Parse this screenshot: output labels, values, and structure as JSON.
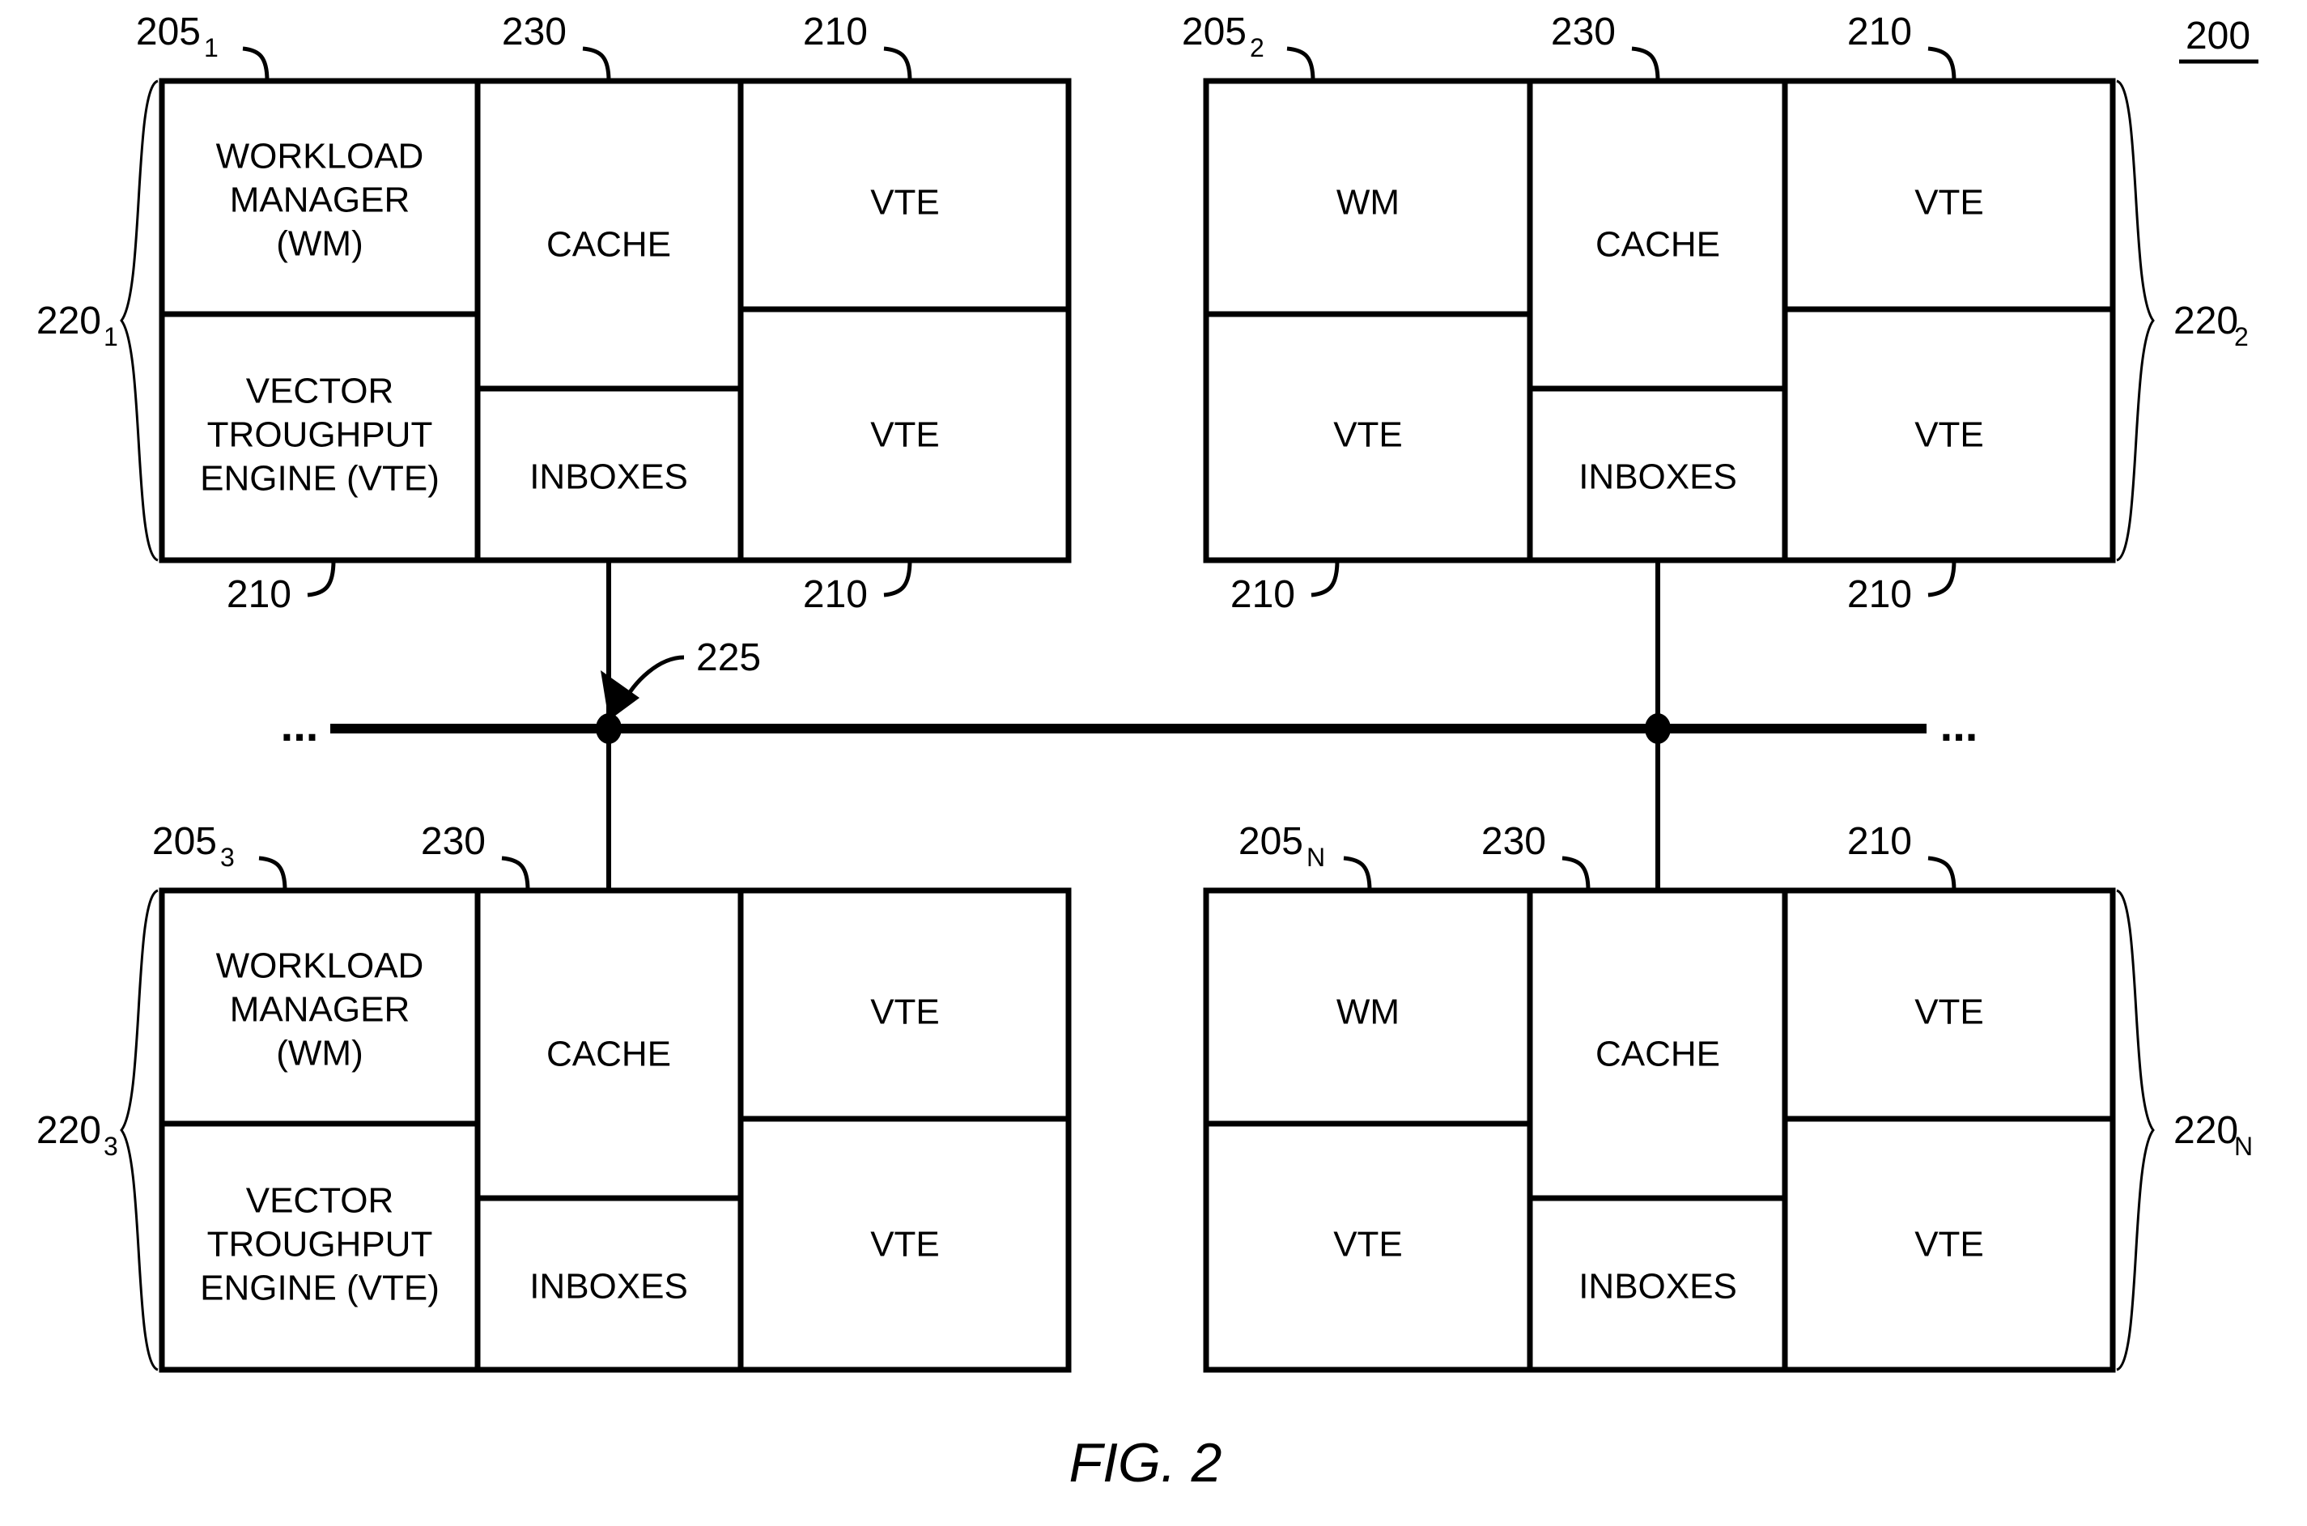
{
  "figure": {
    "caption": "FIG. 2",
    "system_ref": "200"
  },
  "labels": {
    "workload_manager_full": "WORKLOAD MANAGER (WM)",
    "workload_manager_line1": "WORKLOAD",
    "workload_manager_line2": "MANAGER",
    "workload_manager_line3": "(WM)",
    "workload_manager_short": "WM",
    "vte_full_line1": "VECTOR",
    "vte_full_line2": "TROUGHPUT",
    "vte_full_line3": "ENGINE (VTE)",
    "vte_short": "VTE",
    "cache": "CACHE",
    "inboxes": "INBOXES",
    "ellipsis": "..."
  },
  "refs": {
    "node_205": "205",
    "vte_210": "210",
    "node_group_220": "220",
    "bus_225": "225",
    "cache_230": "230",
    "system_200": "200",
    "sub_1": "1",
    "sub_2": "2",
    "sub_3": "3",
    "sub_N": "N"
  },
  "nodes": [
    {
      "id": "node-1",
      "ref": "205",
      "ref_sub": "1",
      "group_ref": "220",
      "group_ref_sub": "1",
      "group_side": "left",
      "wm_label": "WORKLOAD MANAGER (WM)",
      "wm_style": "multiline",
      "vte_label": "VECTOR TROUGHPUT ENGINE (VTE)",
      "vte_style": "multiline",
      "cache_label": "CACHE",
      "inboxes_label": "INBOXES",
      "right_vte_labels": [
        "VTE",
        "VTE"
      ],
      "top_refs": [
        "205",
        "230",
        "210"
      ],
      "bottom_refs": [
        "210",
        "210"
      ],
      "bus_connected": true
    },
    {
      "id": "node-2",
      "ref": "205",
      "ref_sub": "2",
      "group_ref": "220",
      "group_ref_sub": "2",
      "group_side": "right",
      "wm_label": "WM",
      "wm_style": "short",
      "vte_label": "VTE",
      "vte_style": "short",
      "cache_label": "CACHE",
      "inboxes_label": "INBOXES",
      "right_vte_labels": [
        "VTE",
        "VTE"
      ],
      "top_refs": [
        "205",
        "230",
        "210"
      ],
      "bottom_refs": [
        "210",
        "210"
      ],
      "bus_connected": true
    },
    {
      "id": "node-3",
      "ref": "205",
      "ref_sub": "3",
      "group_ref": "220",
      "group_ref_sub": "3",
      "group_side": "left",
      "wm_label": "WORKLOAD MANAGER (WM)",
      "wm_style": "multiline",
      "vte_label": "VECTOR TROUGHPUT ENGINE (VTE)",
      "vte_style": "multiline",
      "cache_label": "CACHE",
      "inboxes_label": "INBOXES",
      "right_vte_labels": [
        "VTE",
        "VTE"
      ],
      "top_refs": [
        "205",
        "230"
      ],
      "bottom_refs": [],
      "bus_connected": true
    },
    {
      "id": "node-N",
      "ref": "205",
      "ref_sub": "N",
      "group_ref": "220",
      "group_ref_sub": "N",
      "group_side": "right",
      "wm_label": "WM",
      "wm_style": "short",
      "vte_label": "VTE",
      "vte_style": "short",
      "cache_label": "CACHE",
      "inboxes_label": "INBOXES",
      "right_vte_labels": [
        "VTE",
        "VTE"
      ],
      "top_refs": [
        "205",
        "230",
        "210"
      ],
      "bottom_refs": [],
      "bus_connected": true
    }
  ],
  "bus": {
    "ref": "225",
    "left_ellipsis": "...",
    "right_ellipsis": "...",
    "node_count": 2
  },
  "colors": {
    "stroke": "#000000",
    "fill": "#ffffff",
    "text": "#000000"
  }
}
